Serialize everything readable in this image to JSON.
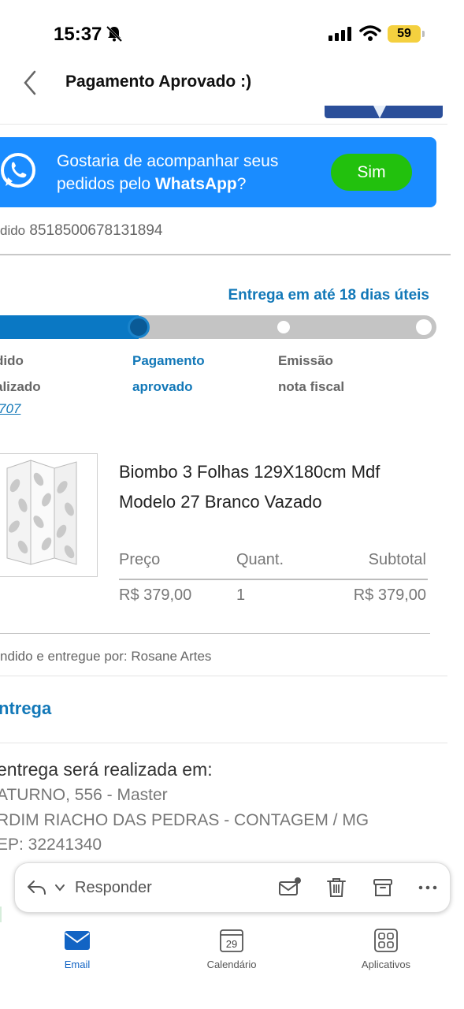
{
  "status_bar": {
    "time": "15:37",
    "battery": "59"
  },
  "header": {
    "title": "Pagamento Aprovado :)"
  },
  "whatsapp_banner": {
    "text_part1": "Gostaria de acompanhar seus pedidos pelo ",
    "text_brand": "WhatsApp",
    "text_part2": "?",
    "button_label": "Sim"
  },
  "order": {
    "label": "dido",
    "number": "8518500678131894"
  },
  "delivery": {
    "eta": "Entrega em até 18 dias úteis"
  },
  "progress": {
    "steps": [
      {
        "line1": "dido",
        "line2": "alizado",
        "link": "707"
      },
      {
        "line1": "Pagamento",
        "line2": "aprovado"
      },
      {
        "line1": "Emissão",
        "line2": "nota fiscal"
      }
    ],
    "current_step": 2
  },
  "product": {
    "title": "Biombo 3 Folhas 129X180cm Mdf Modelo 27 Branco Vazado",
    "headers": {
      "price": "Preço",
      "qty": "Quant.",
      "subtotal": "Subtotal"
    },
    "price": "R$ 379,00",
    "qty": "1",
    "subtotal": "R$ 379,00"
  },
  "seller": "ndido e entregue por: Rosane Artes",
  "delivery_section": {
    "title": "ntrega",
    "heading": "entrega será realizada em:",
    "address_line1": "ATURNO, 556 - Master",
    "address_line2": "RDIM RIACHO DAS PEDRAS - CONTAGEM / MG",
    "address_line3": "EP: 32241340"
  },
  "reply_bar": {
    "reply_label": "Responder"
  },
  "tab_bar": {
    "email": "Email",
    "calendar": "Calendário",
    "calendar_day": "29",
    "apps": "Aplicativos"
  },
  "colors": {
    "accent": "#1278b8",
    "whatsapp_banner": "#1a8cff",
    "yes_button": "#22c10d",
    "battery": "#f4d03f"
  }
}
